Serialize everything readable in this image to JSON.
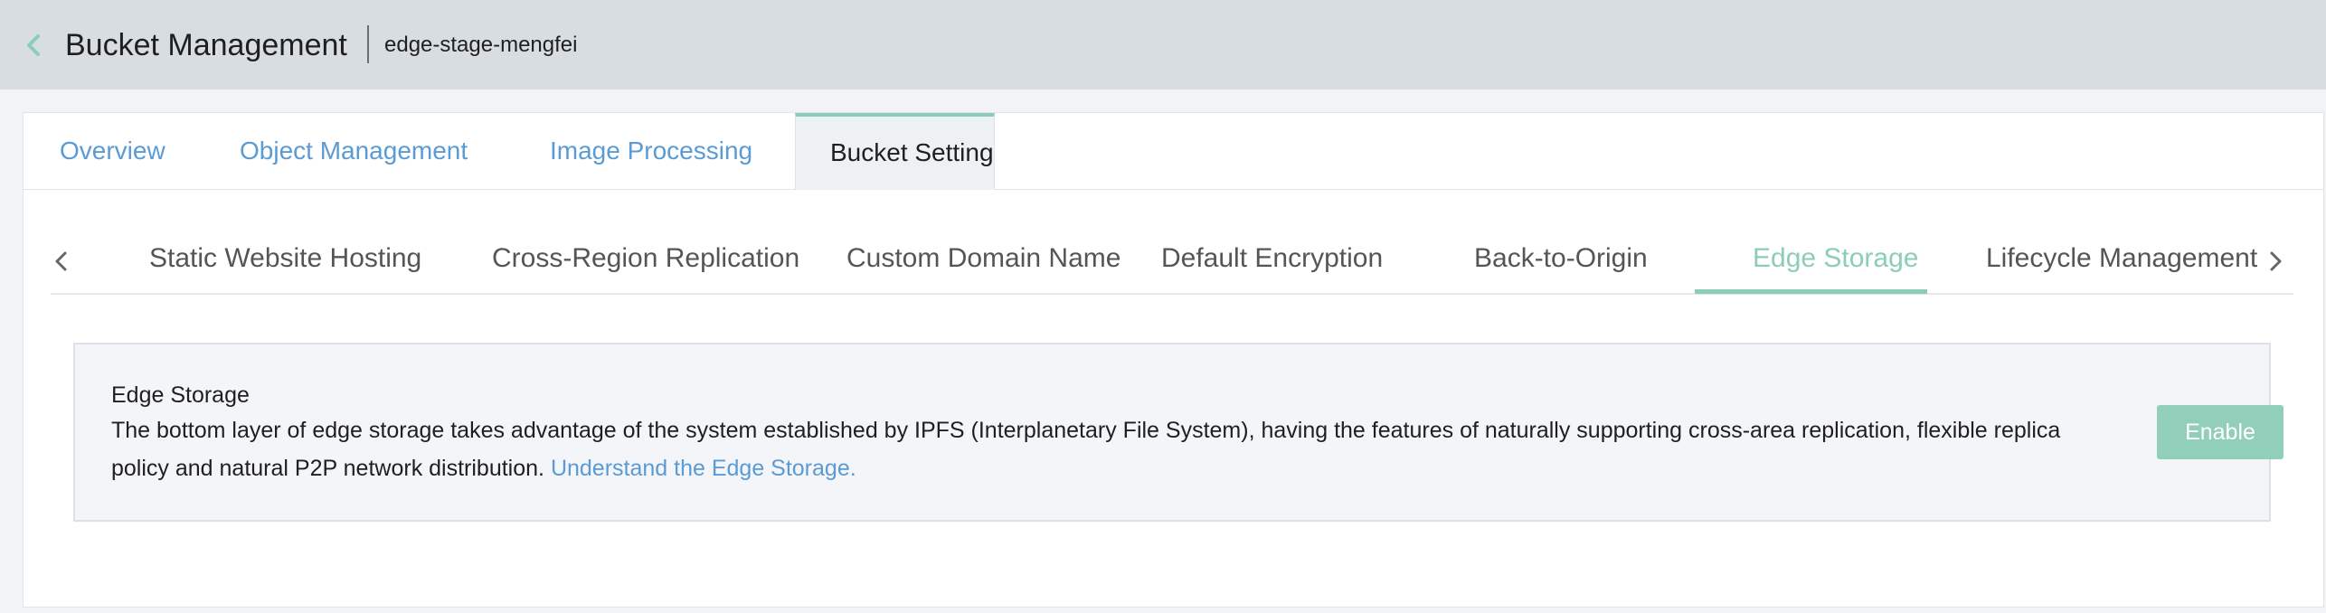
{
  "header": {
    "title": "Bucket Management",
    "bucket_name": "edge-stage-mengfei"
  },
  "main_tabs": [
    {
      "label": "Overview"
    },
    {
      "label": "Object Management"
    },
    {
      "label": "Image Processing"
    },
    {
      "label": "Bucket Setting",
      "active": true
    }
  ],
  "sub_tabs": [
    {
      "label": "Static Website Hosting"
    },
    {
      "label": "Cross-Region Replication"
    },
    {
      "label": "Custom Domain Name"
    },
    {
      "label": "Default Encryption"
    },
    {
      "label": "Back-to-Origin"
    },
    {
      "label": "Edge Storage",
      "active": true
    },
    {
      "label": "Lifecycle Management"
    }
  ],
  "edge_storage": {
    "title": "Edge Storage",
    "description": "The bottom layer of edge storage takes advantage of the system established by IPFS (Interplanetary File System), having the features of naturally supporting cross-area replication, flexible replica policy and natural P2P network distribution.",
    "link_text": "Understand the Edge Storage.",
    "enable_label": "Enable"
  },
  "colors": {
    "accent": "#8ccdb8",
    "link": "#5a9bd5",
    "header_bg": "#d8dde1"
  },
  "icons": {
    "back": "chevron-left-icon",
    "scroll_left": "chevron-left-icon",
    "scroll_right": "chevron-right-icon"
  }
}
